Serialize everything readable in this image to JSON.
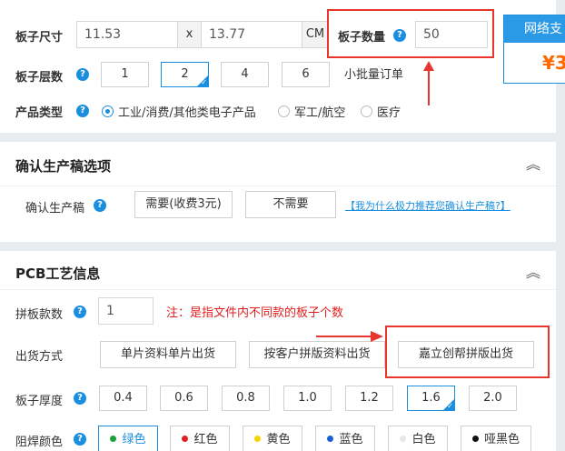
{
  "top": {
    "size_label": "板子尺寸",
    "width_value": "11.53",
    "times_sign": "x",
    "height_value": "13.77",
    "unit": "CM",
    "qty_label": "板子数量",
    "qty_value": "50",
    "small_batch": "小批量订单",
    "layers_label": "板子层数",
    "layers": [
      "1",
      "2",
      "4",
      "6"
    ],
    "layers_selected": "2",
    "type_label": "产品类型",
    "types": [
      "工业/消费/其他类电子产品",
      "军工/航空",
      "医疗"
    ],
    "promo_title": "网络支",
    "promo_price": "¥3"
  },
  "confirm": {
    "title": "确认生产稿选项",
    "row_label": "确认生产稿",
    "need": "需要(收费3元)",
    "no_need": "不需要",
    "link": "【我为什么极力推荐您确认生产稿?】"
  },
  "pcb": {
    "title": "PCB工艺信息",
    "panel_count_label": "拼板款数",
    "panel_count_value": "1",
    "panel_note": "注：是指文件内不同款的板子个数",
    "ship_label": "出货方式",
    "ship_options": [
      "单片资料单片出货",
      "按客户拼版资料出货",
      "嘉立创帮拼版出货"
    ],
    "thickness_label": "板子厚度",
    "thickness": [
      "0.4",
      "0.6",
      "0.8",
      "1.0",
      "1.2",
      "1.6",
      "2.0"
    ],
    "thickness_selected": "1.6",
    "mask_label": "阻焊颜色",
    "mask_colors": [
      "绿色",
      "红色",
      "黄色",
      "蓝色",
      "白色",
      "哑黑色"
    ]
  },
  "help_glyph": "?",
  "colors": {
    "accent": "#1a8fe0",
    "annotation_red": "#e8352e",
    "price_orange": "#ff6a00",
    "mask_green": "#1aa13a",
    "mask_red": "#e21e1e",
    "mask_yellow": "#f6d400",
    "mask_blue": "#1a5fd6",
    "mask_white": "#e6e6e6",
    "mask_black": "#111111"
  }
}
